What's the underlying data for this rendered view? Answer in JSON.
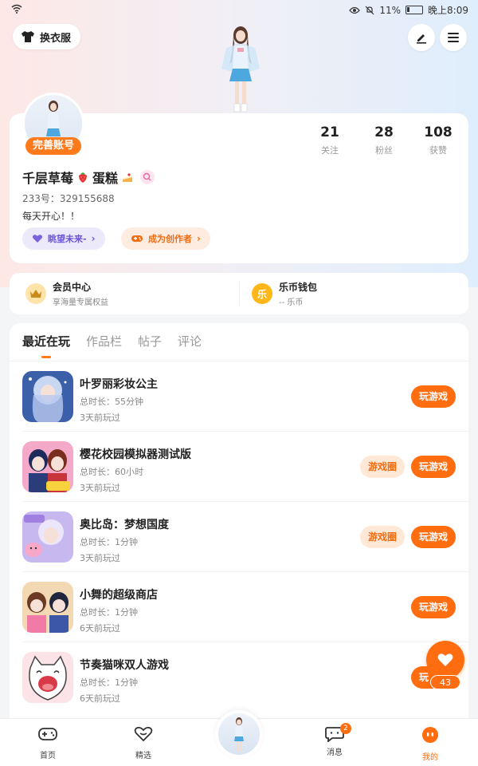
{
  "status_bar": {
    "battery_percent": "11%",
    "time": "晚上8:09"
  },
  "header": {
    "dress_label": "换衣服"
  },
  "profile": {
    "complete_badge": "完善账号",
    "stats": {
      "follow_count": "21",
      "follow_label": "关注",
      "fans_count": "28",
      "fans_label": "粉丝",
      "likes_count": "108",
      "likes_label": "获赞"
    },
    "name_part1": "千层草莓",
    "name_part2": "蛋糕",
    "user_id": "233号：329155688",
    "bio": "每天开心！！",
    "chip_look": "眺望未来-",
    "chip_creator": "成为创作者"
  },
  "wallet": {
    "vip_title": "会员中心",
    "vip_sub": "享海量专属权益",
    "coin_title": "乐币钱包",
    "coin_sub": "-- 乐币",
    "coin_symbol": "乐"
  },
  "tabs": [
    {
      "label": "最近在玩"
    },
    {
      "label": "作品栏"
    },
    {
      "label": "帖子"
    },
    {
      "label": "评论"
    }
  ],
  "games": [
    {
      "name": "叶罗丽彩妆公主",
      "duration": "总时长：55分钟",
      "last": "3天前玩过",
      "play": "玩游戏"
    },
    {
      "name": "樱花校园模拟器测试版",
      "duration": "总时长：60小时",
      "last": "3天前玩过",
      "circle": "游戏圈",
      "play": "玩游戏"
    },
    {
      "name": "奥比岛：梦想国度",
      "duration": "总时长：1分钟",
      "last": "3天前玩过",
      "circle": "游戏圈",
      "play": "玩游戏"
    },
    {
      "name": "小舞的超级商店",
      "duration": "总时长：1分钟",
      "last": "6天前玩过",
      "play": "玩游戏"
    },
    {
      "name": "节奏猫咪双人游戏",
      "duration": "总时长：1分钟",
      "last": "6天前玩过",
      "play": "玩"
    }
  ],
  "float_like": {
    "count": "43"
  },
  "bottom_nav": {
    "home": "首页",
    "pick": "精选",
    "msg": "消息",
    "msg_badge": "2",
    "mine": "我的"
  },
  "colors": {
    "accent": "#ff6d10",
    "purple": "#6d55d9"
  }
}
